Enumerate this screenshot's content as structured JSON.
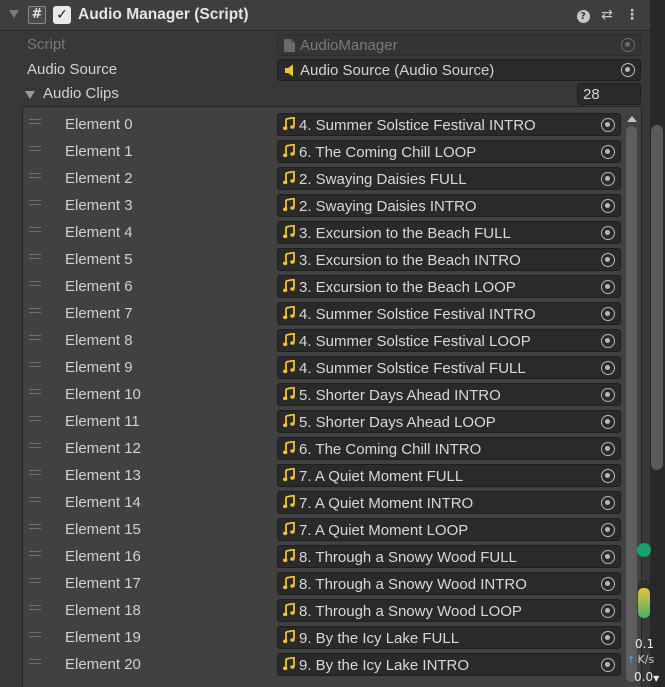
{
  "component": {
    "title": "Audio Manager (Script)",
    "enabled": true,
    "icons": [
      "help-icon",
      "preset-icon",
      "more-icon"
    ]
  },
  "fields": {
    "script": {
      "label": "Script",
      "value": "AudioManager"
    },
    "audio_source": {
      "label": "Audio Source",
      "value": "Audio Source (Audio Source)"
    },
    "audio_clips": {
      "label": "Audio Clips",
      "size": "28"
    }
  },
  "elements": [
    {
      "label": "Element 0",
      "clip": "4. Summer Solstice Festival INTRO"
    },
    {
      "label": "Element 1",
      "clip": "6. The Coming Chill LOOP"
    },
    {
      "label": "Element 2",
      "clip": "2. Swaying Daisies FULL"
    },
    {
      "label": "Element 3",
      "clip": "2. Swaying Daisies INTRO"
    },
    {
      "label": "Element 4",
      "clip": "3. Excursion to the Beach FULL"
    },
    {
      "label": "Element 5",
      "clip": "3. Excursion to the Beach INTRO"
    },
    {
      "label": "Element 6",
      "clip": "3. Excursion to the Beach LOOP"
    },
    {
      "label": "Element 7",
      "clip": "4. Summer Solstice Festival INTRO"
    },
    {
      "label": "Element 8",
      "clip": "4. Summer Solstice Festival LOOP"
    },
    {
      "label": "Element 9",
      "clip": "4. Summer Solstice Festival FULL"
    },
    {
      "label": "Element 10",
      "clip": "5. Shorter Days Ahead INTRO"
    },
    {
      "label": "Element 11",
      "clip": "5. Shorter Days Ahead LOOP"
    },
    {
      "label": "Element 12",
      "clip": "6. The Coming Chill INTRO"
    },
    {
      "label": "Element 13",
      "clip": "7. A Quiet Moment FULL"
    },
    {
      "label": "Element 14",
      "clip": "7. A Quiet Moment INTRO"
    },
    {
      "label": "Element 15",
      "clip": "7. A Quiet Moment LOOP"
    },
    {
      "label": "Element 16",
      "clip": "8. Through a Snowy Wood FULL"
    },
    {
      "label": "Element 17",
      "clip": "8. Through a Snowy Wood INTRO"
    },
    {
      "label": "Element 18",
      "clip": "8. Through a Snowy Wood LOOP"
    },
    {
      "label": "Element 19",
      "clip": "9. By the Icy Lake FULL"
    },
    {
      "label": "Element 20",
      "clip": "9. By the Icy Lake INTRO"
    }
  ],
  "network": {
    "status_color": "#16a36b",
    "meter_level": 0.8,
    "up_value": "0.1",
    "unit": "K/s",
    "down_value": "0.0"
  },
  "colors": {
    "note_icon": "#f0c23a",
    "speaker_icon": "#f0c23a"
  }
}
